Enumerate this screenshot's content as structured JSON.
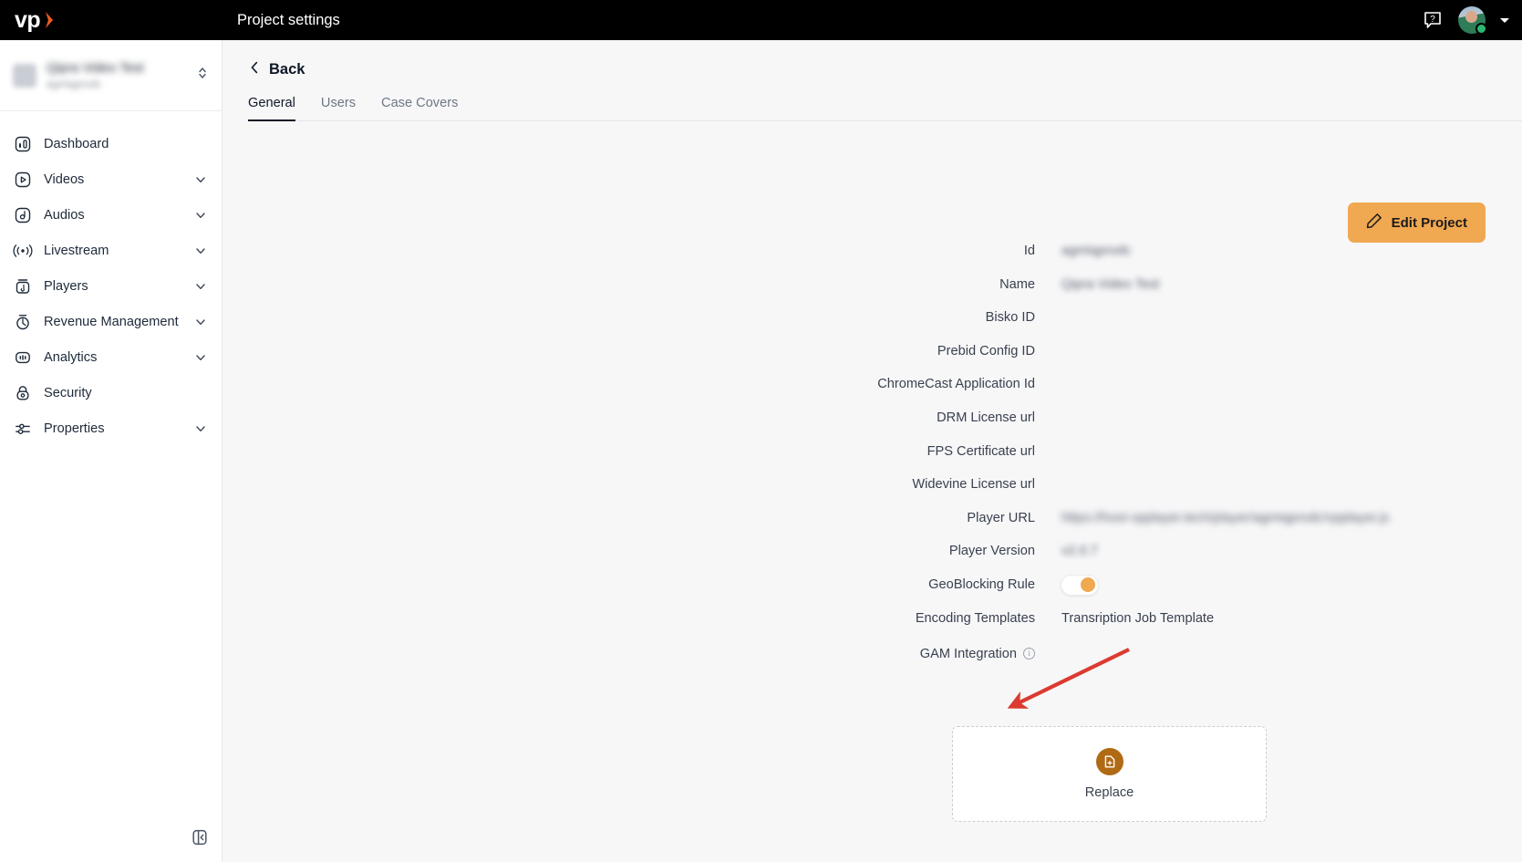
{
  "topbar": {
    "logo_text": "vp",
    "logo_icon": "chevron-right-orange-icon",
    "title": "Project settings",
    "help_icon": "help-question-bubble-icon",
    "avatar_icon": "user-avatar",
    "status_badge": "online-green-badge",
    "caret_icon": "chevron-down-icon"
  },
  "sidebar": {
    "project_switcher": {
      "name": "",
      "subtitle": "",
      "chevron_icon": "chevron-up-down-icon",
      "thumbnail_icon": "project-thumbnail"
    },
    "items": [
      {
        "label": "Dashboard",
        "icon": "dashboard-icon",
        "expandable": false
      },
      {
        "label": "Videos",
        "icon": "video-play-icon",
        "expandable": true
      },
      {
        "label": "Audios",
        "icon": "audio-note-icon",
        "expandable": true
      },
      {
        "label": "Livestream",
        "icon": "livestream-broadcast-icon",
        "expandable": true
      },
      {
        "label": "Players",
        "icon": "player-device-icon",
        "expandable": true
      },
      {
        "label": "Revenue Management",
        "icon": "revenue-gauge-icon",
        "expandable": true
      },
      {
        "label": "Analytics",
        "icon": "analytics-bars-icon",
        "expandable": true
      },
      {
        "label": "Security",
        "icon": "lock-icon",
        "expandable": false
      },
      {
        "label": "Properties",
        "icon": "sliders-icon",
        "expandable": true
      }
    ],
    "collapse_icon": "panel-collapse-left-icon"
  },
  "main": {
    "back_label": "Back",
    "back_icon": "chevron-left-icon",
    "tabs": [
      {
        "label": "General",
        "active": true
      },
      {
        "label": "Users",
        "active": false
      },
      {
        "label": "Case Covers",
        "active": false
      }
    ],
    "edit_button": {
      "label": "Edit Project",
      "icon": "pencil-edit-icon",
      "color": "#F0A851"
    },
    "fields": [
      {
        "label": "Id",
        "value": "",
        "blurred": true
      },
      {
        "label": "Name",
        "value": "",
        "blurred": true
      },
      {
        "label": "Bisko ID",
        "value": "",
        "blurred": false
      },
      {
        "label": "Prebid Config ID",
        "value": "",
        "blurred": false
      },
      {
        "label": "ChromeCast Application Id",
        "value": "",
        "blurred": false
      },
      {
        "label": "DRM License url",
        "value": "",
        "blurred": false
      },
      {
        "label": "FPS Certificate url",
        "value": "",
        "blurred": false
      },
      {
        "label": "Widevine License url",
        "value": "",
        "blurred": false
      },
      {
        "label": "Player URL",
        "value": "",
        "blurred": true
      },
      {
        "label": "Player Version",
        "value": "",
        "blurred": true
      }
    ],
    "geoblocking": {
      "label": "GeoBlocking Rule",
      "enabled": true,
      "knob_color": "#F0A851"
    },
    "encoding_templates": {
      "label": "Encoding Templates",
      "value": "Transription Job Template"
    },
    "gam_integration": {
      "label": "GAM Integration",
      "info_icon": "info-circle-icon",
      "info_glyph": "i"
    },
    "dropzone": {
      "label": "Replace",
      "icon": "file-add-icon",
      "icon_color": "#B06A14"
    },
    "annotation": {
      "type": "arrow",
      "color": "#DB3B30"
    }
  }
}
